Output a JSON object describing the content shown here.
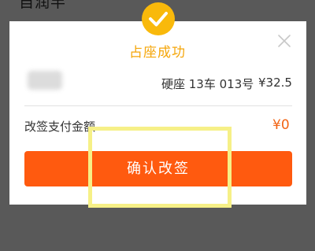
{
  "background": {
    "partial_text": "自润半"
  },
  "dialog": {
    "title": "占座成功",
    "seat_info": "硬座 13车 013号",
    "price": "¥32.5",
    "pay_label": "改签支付金额",
    "pay_amount": "¥0",
    "confirm_label": "确认改签"
  },
  "icons": {
    "status": "check-circle-icon",
    "close": "close-icon"
  },
  "colors": {
    "accent": "#ff5a0f",
    "success_badge": "#f9b90b",
    "title": "#f5a609",
    "amount": "#f26414",
    "highlight": "#f6f087",
    "overlay": "#595959"
  }
}
